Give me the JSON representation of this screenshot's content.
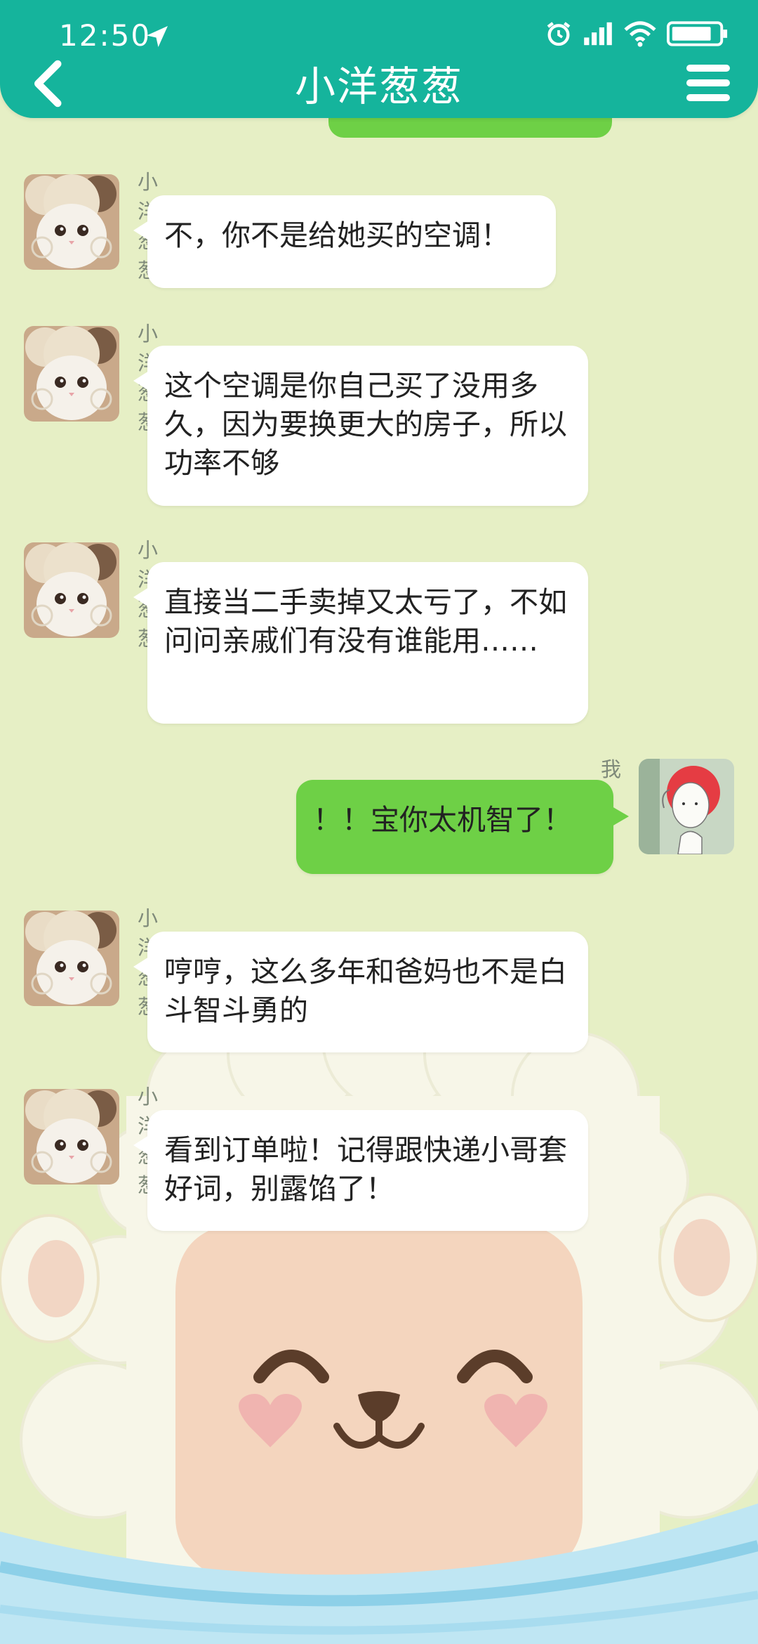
{
  "status_bar": {
    "time": "12:50"
  },
  "header": {
    "title": "小洋葱葱"
  },
  "messages": [
    {
      "side": "left",
      "sender": "小洋葱葱",
      "text": "不，你不是给她买的空调！"
    },
    {
      "side": "left",
      "sender": "小洋葱葱",
      "text": "这个空调是你自己买了没用多久，因为要换更大的房子，所以功率不够"
    },
    {
      "side": "left",
      "sender": "小洋葱葱",
      "text": "直接当二手卖掉又太亏了，不如问问亲戚们有没有谁能用……"
    },
    {
      "side": "right",
      "sender": "我",
      "text": "！！宝你太机智了！"
    },
    {
      "side": "left",
      "sender": "小洋葱葱",
      "text": "哼哼，这么多年和爸妈也不是白斗智斗勇的"
    },
    {
      "side": "left",
      "sender": "小洋葱葱",
      "text": "看到订单啦！记得跟快递小哥套好词，别露馅了！"
    }
  ],
  "colors": {
    "header": "#15b49c",
    "my_bubble": "#6ed046",
    "background": "#e6efc5"
  }
}
